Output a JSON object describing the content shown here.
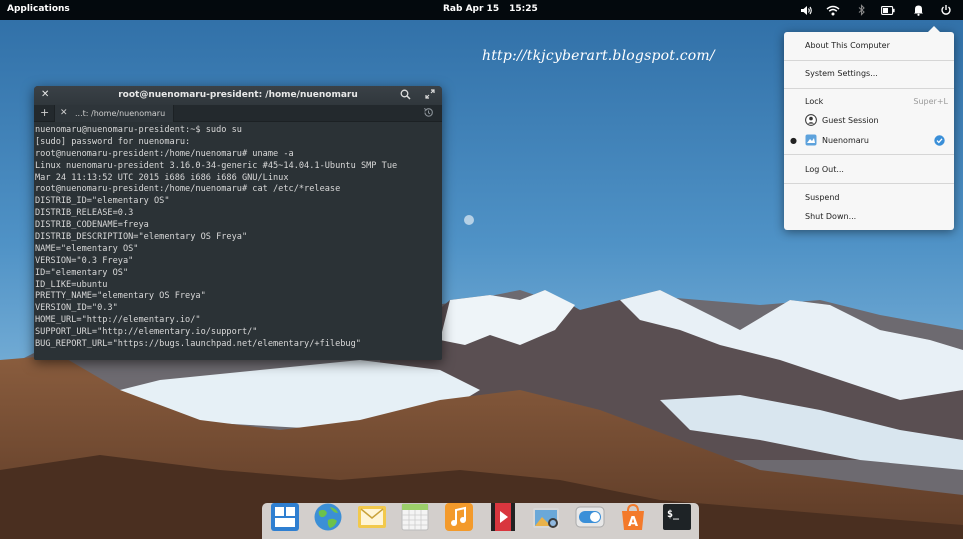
{
  "panel": {
    "applications_label": "Applications",
    "date": "Rab Apr 15",
    "time": "15:25",
    "indicators": [
      "volume-icon",
      "wifi-icon",
      "bluetooth-icon",
      "battery-icon",
      "notification-bell-icon",
      "power-icon"
    ]
  },
  "watermark": "http://tkjcyberart.blogspot.com/",
  "terminal": {
    "title": "root@nuenomaru-president: /home/nuenomaru",
    "tab_label": "...t: /home/nuenomaru",
    "lines": [
      "nuenomaru@nuenomaru-president:~$ sudo su",
      "[sudo] password for nuenomaru:",
      "root@nuenomaru-president:/home/nuenomaru# uname -a",
      "Linux nuenomaru-president 3.16.0-34-generic #45~14.04.1-Ubuntu SMP Tue",
      "Mar 24 11:13:52 UTC 2015 i686 i686 i686 GNU/Linux",
      "root@nuenomaru-president:/home/nuenomaru# cat /etc/*release",
      "DISTRIB_ID=\"elementary OS\"",
      "DISTRIB_RELEASE=0.3",
      "DISTRIB_CODENAME=freya",
      "DISTRIB_DESCRIPTION=\"elementary OS Freya\"",
      "NAME=\"elementary OS\"",
      "VERSION=\"0.3 Freya\"",
      "ID=\"elementary OS\"",
      "ID_LIKE=ubuntu",
      "PRETTY_NAME=\"elementary OS Freya\"",
      "VERSION_ID=\"0.3\"",
      "HOME_URL=\"http://elementary.io/\"",
      "SUPPORT_URL=\"http://elementary.io/support/\"",
      "BUG_REPORT_URL=\"https://bugs.launchpad.net/elementary/+filebug\""
    ]
  },
  "menu": {
    "about": "About This Computer",
    "settings": "System Settings...",
    "lock": "Lock",
    "lock_shortcut": "Super+L",
    "guest": "Guest Session",
    "user": "Nuenomaru",
    "logout": "Log Out...",
    "suspend": "Suspend",
    "shutdown": "Shut Down..."
  },
  "dock": {
    "apps": [
      "multitasking-view-icon",
      "web-browser-icon",
      "mail-icon",
      "calendar-icon",
      "music-icon",
      "videos-icon",
      "photos-icon",
      "system-settings-icon",
      "app-center-icon",
      "terminal-icon"
    ]
  },
  "colors": {
    "panel_bg": "#000000",
    "terminal_bg": "#2b3236",
    "menu_bg": "#f7f7f7",
    "accent": "#3a8fd8"
  }
}
